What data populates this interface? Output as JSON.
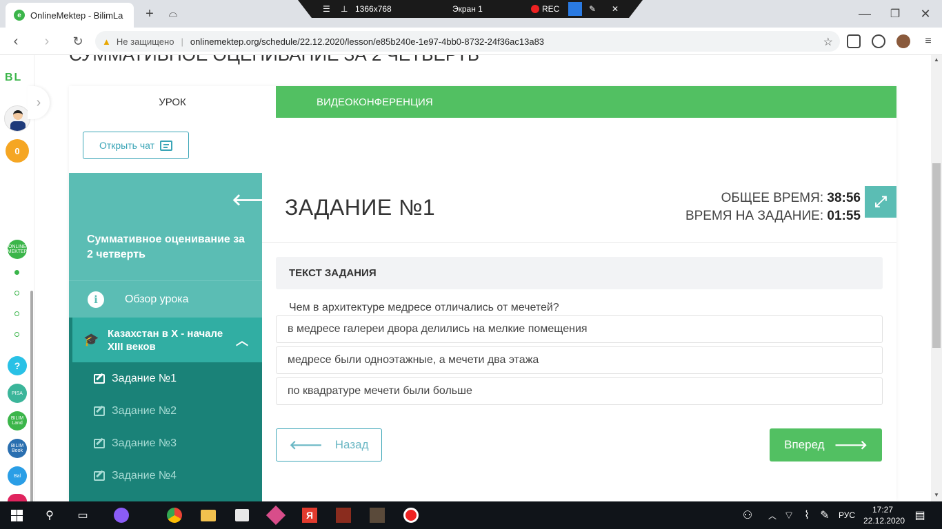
{
  "browser": {
    "tab_title": "OnlineMektep - BilimLa",
    "tab_favicon": "e",
    "security_label": "Не защищено",
    "url": "onlinemektep.org/schedule/22.12.2020/lesson/e85b240e-1e97-4bb0-8732-24f36ac13a83"
  },
  "recorder": {
    "resolution": "1366x768",
    "screen": "Экран 1",
    "rec_label": "REC"
  },
  "rail": {
    "logo": "BL",
    "coins": "0",
    "help": "?",
    "apps": [
      "ONLINE MEKTEP",
      "PISA",
      "BILIM Land",
      "BILIM Book",
      "Bal"
    ]
  },
  "page": {
    "heading": "СУММАТИВНОЕ ОЦЕНИВАНИЕ ЗА 2 ЧЕТВЕРТЬ"
  },
  "tabs": {
    "lesson": "УРОК",
    "video": "ВИДЕОКОНФЕРЕНЦИЯ"
  },
  "chat_button": "Открыть чат",
  "sidebar": {
    "title": "Суммативное оценивание за 2 четверть",
    "overview": "Обзор урока",
    "section": "Казахстан в X - начале XIII веков",
    "tasks": [
      "Задание №1",
      "Задание №2",
      "Задание №3",
      "Задание №4"
    ]
  },
  "task": {
    "heading": "ЗАДАНИЕ №1",
    "total_time_label": "ОБЩЕЕ ВРЕМЯ:",
    "total_time": "38:56",
    "task_time_label": "ВРЕМЯ НА ЗАДАНИЕ:",
    "task_time": "01:55",
    "text_header": "ТЕКСТ ЗАДАНИЯ",
    "question": "Чем в архитектуре медресе отличались от мечетей?",
    "options": [
      "в медресе галереи двора делились на мелкие помещения",
      "медресе были одноэтажные, а мечети два этажа",
      "по квадратуре мечети были больше"
    ],
    "back_label": "Назад",
    "next_label": "Вперед"
  },
  "taskbar": {
    "lang": "РУС",
    "time": "17:27",
    "date": "22.12.2020"
  },
  "colors": {
    "green": "#52c062",
    "teal": "#5bbdb4",
    "dark_teal": "#1a8278",
    "section_teal": "#31aea3"
  }
}
